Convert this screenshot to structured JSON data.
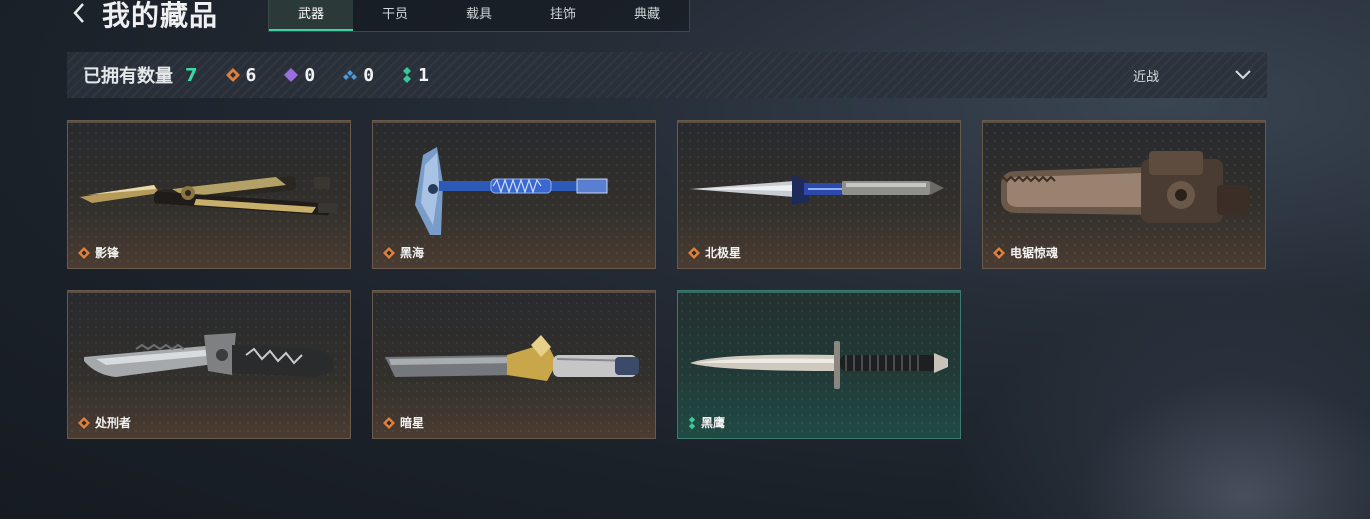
{
  "header": {
    "title": "我的藏品"
  },
  "tabs": [
    {
      "label": "武器",
      "active": true
    },
    {
      "label": "干员",
      "active": false
    },
    {
      "label": "载具",
      "active": false
    },
    {
      "label": "挂饰",
      "active": false
    },
    {
      "label": "典藏",
      "active": false
    }
  ],
  "summary": {
    "owned_label": "已拥有数量",
    "owned_count": "7",
    "rarities": [
      {
        "icon": "orange-diamond-icon",
        "color": "#e0803a",
        "count": "6"
      },
      {
        "icon": "purple-diamond-icon",
        "color": "#9b6ee0",
        "count": "0"
      },
      {
        "icon": "blue-diamond-icon",
        "color": "#4f9ad8",
        "count": "0"
      },
      {
        "icon": "green-diamond-icon",
        "color": "#36c99a",
        "count": "1"
      }
    ]
  },
  "filter": {
    "label": "近战"
  },
  "items": [
    {
      "name": "影锋",
      "rarity": "orange",
      "weapon": "butterfly-knife"
    },
    {
      "name": "黑海",
      "rarity": "orange",
      "weapon": "axe"
    },
    {
      "name": "北极星",
      "rarity": "orange",
      "weapon": "dagger"
    },
    {
      "name": "电锯惊魂",
      "rarity": "orange",
      "weapon": "chainsaw"
    },
    {
      "name": "处刑者",
      "rarity": "orange",
      "weapon": "serrated-knife"
    },
    {
      "name": "暗星",
      "rarity": "orange",
      "weapon": "long-blade"
    },
    {
      "name": "黑鹰",
      "rarity": "green",
      "weapon": "combat-knife"
    }
  ],
  "colors": {
    "accent": "#3bd8a8",
    "orange_rarity": "#e0803a",
    "green_rarity": "#36c99a"
  }
}
